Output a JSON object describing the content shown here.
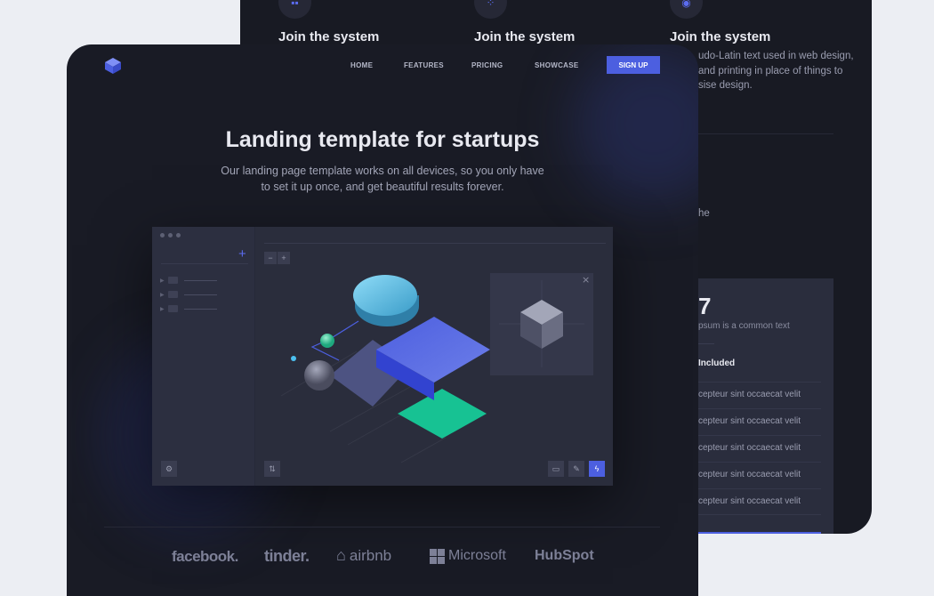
{
  "back_page": {
    "features": [
      {
        "icon": "layout-blocks-icon",
        "title": "Join the system"
      },
      {
        "icon": "dots-grid-icon",
        "title": "Join the system"
      },
      {
        "icon": "target-circle-icon",
        "title": "Join the system"
      }
    ],
    "description_lines": [
      "udo-Latin text used in web design,",
      "and printing in place of things to",
      "sise design."
    ],
    "partial_text": "he",
    "pricing": {
      "price": "7",
      "subtitle": "psum is a common text",
      "included_label": "Included",
      "items": [
        "cepteur sint occaecat velit",
        "cepteur sint occaecat velit",
        "cepteur sint occaecat velit",
        "cepteur sint occaecat velit",
        "cepteur sint occaecat velit"
      ]
    }
  },
  "header": {
    "nav": [
      "HOME",
      "FEATURES",
      "PRICING",
      "SHOWCASE"
    ],
    "signup_label": "SIGN UP"
  },
  "hero": {
    "title": "Landing template for startups",
    "subtitle": "Our landing page template works on all devices, so you only have to set it up once, and get beautiful results forever."
  },
  "mockup": {
    "zoom_out": "−",
    "zoom_in": "+",
    "add": "+",
    "close": "×"
  },
  "clients": [
    "facebook.",
    "tinder.",
    "airbnb",
    "Microsoft",
    "HubSpot"
  ],
  "colors": {
    "accent": "#4c5fe0",
    "background": "#191b25",
    "green": "#17c293"
  }
}
